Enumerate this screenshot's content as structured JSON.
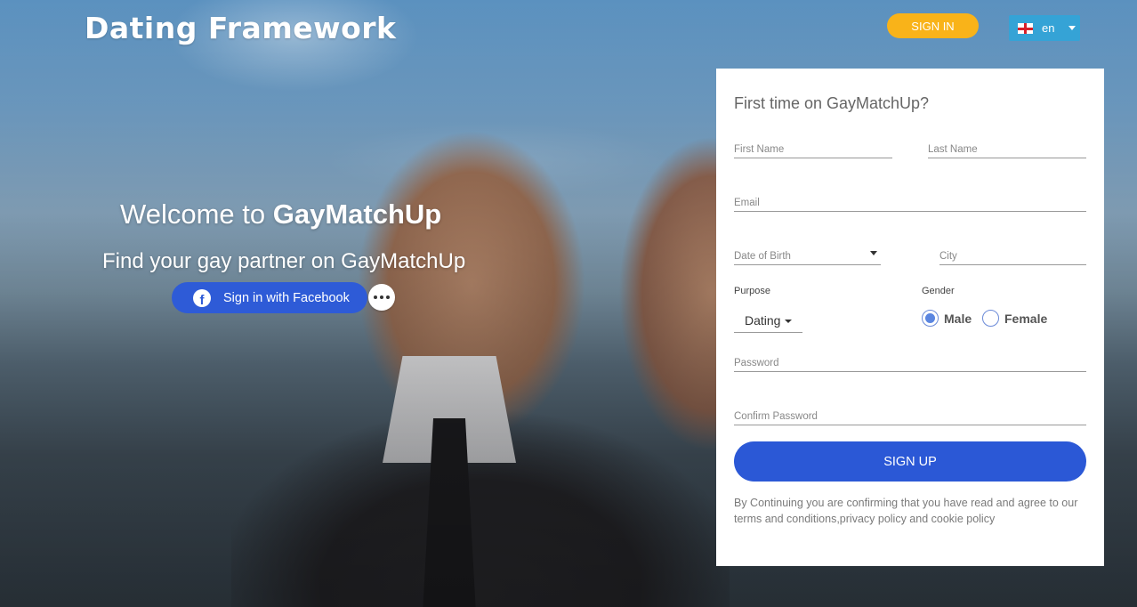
{
  "header": {
    "logo": "Dating Framework",
    "signin_label": "SIGN IN",
    "language": "en"
  },
  "hero": {
    "welcome_prefix": "Welcome to",
    "welcome_brand": "GayMatchUp",
    "tagline": "Find your gay partner on GayMatchUp",
    "facebook_label": "Sign in with Facebook",
    "facebook_icon": "f"
  },
  "form": {
    "title": "First time on GayMatchUp?",
    "first_name_placeholder": "First Name",
    "last_name_placeholder": "Last Name",
    "email_placeholder": "Email",
    "dob_placeholder": "Date of Birth",
    "city_placeholder": "City",
    "purpose_label": "Purpose",
    "purpose_value": "Dating",
    "gender_label": "Gender",
    "gender_options": [
      "Male",
      "Female"
    ],
    "gender_selected": "Male",
    "password_placeholder": "Password",
    "confirm_password_placeholder": "Confirm Password",
    "signup_label": "SIGN UP",
    "disclaimer": "By Continuing you are confirming that you have read and agree to our terms and conditions,privacy policy and cookie policy"
  },
  "colors": {
    "signin": "#f9b319",
    "language": "#35a3d6",
    "primary": "#2b58d6"
  }
}
